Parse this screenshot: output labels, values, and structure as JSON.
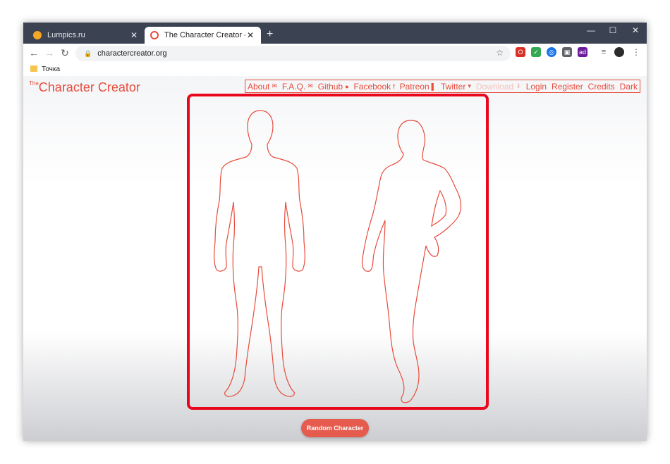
{
  "browser": {
    "tabs": [
      {
        "title": "Lumpics.ru",
        "favicon_color": "#f5a623"
      },
      {
        "title": "The Character Creator - Build visual",
        "favicon_color": "#e74c3c"
      }
    ],
    "address": "charactercreator.org",
    "bookmark": "Точка"
  },
  "site": {
    "logo_prefix": "The",
    "logo_title": "Character Creator",
    "accent": "#e74c3c",
    "nav": [
      {
        "label": "About",
        "icon": "✉"
      },
      {
        "label": "F.A.Q.",
        "icon": "✉"
      },
      {
        "label": "Github",
        "icon": "●"
      },
      {
        "label": "Facebook",
        "icon": "f"
      },
      {
        "label": "Patreon",
        "icon": "▌"
      },
      {
        "label": "Twitter",
        "icon": "▾"
      },
      {
        "label": "Download",
        "icon": "⬇"
      },
      {
        "label": "Login"
      },
      {
        "label": "Register"
      },
      {
        "label": "Credits"
      },
      {
        "label": "Dark"
      }
    ],
    "random_button": "Random Character"
  }
}
